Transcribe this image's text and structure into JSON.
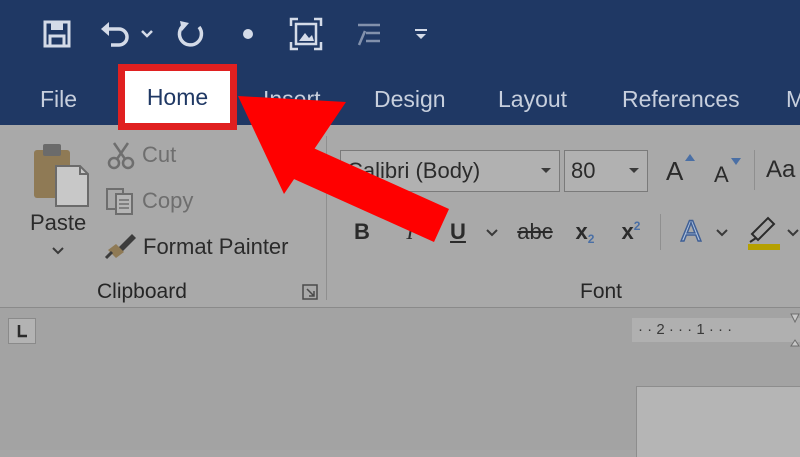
{
  "tabs": {
    "file": "File",
    "home": "Home",
    "insert": "Insert",
    "design": "Design",
    "layout": "Layout",
    "references": "References",
    "more": "M"
  },
  "clipboard": {
    "paste": "Paste",
    "cut": "Cut",
    "copy": "Copy",
    "format_painter": "Format Painter",
    "group_label": "Clipboard"
  },
  "font": {
    "font_name": "Calibri (Body)",
    "font_size": "80",
    "bold": "B",
    "italic": "I",
    "underline": "U",
    "strikethrough": "abc",
    "subscript_base": "x",
    "subscript_mark": "2",
    "superscript_base": "x",
    "superscript_mark": "2",
    "change_case": "Aa",
    "grow_font": "A",
    "shrink_font": "A",
    "text_effects": "A",
    "group_label": "Font"
  },
  "ruler": {
    "marks": "· · 2 · · · 1 · · · "
  },
  "colors": {
    "titlebar": "#1f3864",
    "highlight_box": "#e02020",
    "arrow": "#ff0000"
  }
}
